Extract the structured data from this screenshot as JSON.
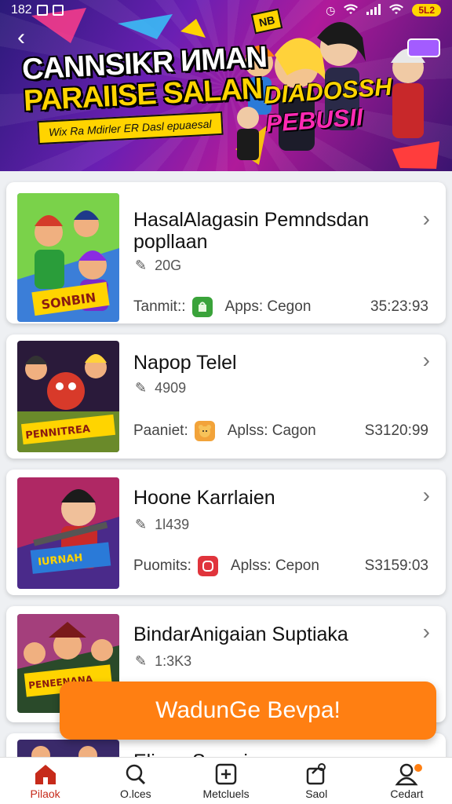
{
  "status_bar": {
    "time": "182",
    "battery": "5L2"
  },
  "hero": {
    "title_line1": "CANNSIKR ИMAN",
    "title_line2": "PARAIISE SALAN",
    "strip": "Wix Ra Mdirler ER Dasl epuaesal",
    "badge_line1": "DIADOSSH",
    "badge_line2": "PEBUSII",
    "tag": "NB"
  },
  "items": [
    {
      "title": "HasalAlagasin Pemndsdan popllaan",
      "downloads": "20G",
      "label": "Tanmit::",
      "apps": "Apps: Cegon",
      "time": "35:23:93",
      "icon": "green-bag-icon",
      "icon_color": "#3aa33a"
    },
    {
      "title": "Napop Telel",
      "downloads": "4909",
      "label": "Paaniet:",
      "apps": "Aplss: Cagon",
      "time": "S3120:99",
      "icon": "yellow-bear-icon",
      "icon_color": "#f2a33a"
    },
    {
      "title": "Hoone Karrlaien",
      "downloads": "1l439",
      "label": "Puomits:",
      "apps": "Aplss: Cepon",
      "time": "S3159:03",
      "icon": "red-ring-icon",
      "icon_color": "#e0343c"
    },
    {
      "title": "BindarAnigaian Suptiaka",
      "downloads": "1:3K3",
      "label": "",
      "apps": "",
      "time": ""
    },
    {
      "title": "Elizan Sasarion",
      "downloads": "",
      "label": "",
      "apps": "",
      "time": ""
    }
  ],
  "cta_label": "WadunGe Bevpa!",
  "nav": [
    {
      "label": "Pilaok",
      "icon": "home-icon"
    },
    {
      "label": "O.lces",
      "icon": "search-icon"
    },
    {
      "label": "Metcluels",
      "icon": "add-box-icon"
    },
    {
      "label": "Saol",
      "icon": "bag-icon"
    },
    {
      "label": "Cedart",
      "icon": "user-icon"
    }
  ],
  "colors": {
    "accent": "#ff7f12",
    "active_nav": "#c62a1a"
  }
}
